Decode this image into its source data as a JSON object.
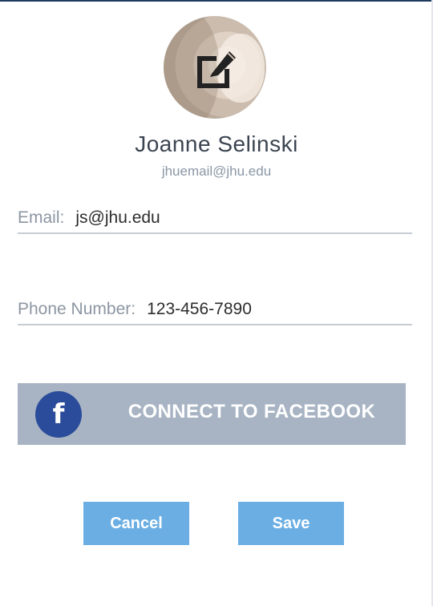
{
  "profile": {
    "name": "Joanne Selinski",
    "email_subtitle": "jhuemail@jhu.edu",
    "avatar_icon": "edit-icon"
  },
  "form": {
    "email": {
      "label": "Email:",
      "value": "js@jhu.edu"
    },
    "phone": {
      "label": "Phone Number:",
      "value": "123-456-7890"
    }
  },
  "facebook": {
    "label": "CONNECT TO FACEBOOK",
    "logo_letter": "f",
    "logo_color": "#2a4c9a",
    "button_color": "#a8b4c4"
  },
  "actions": {
    "cancel_label": "Cancel",
    "save_label": "Save",
    "button_color": "#6aaee3"
  }
}
